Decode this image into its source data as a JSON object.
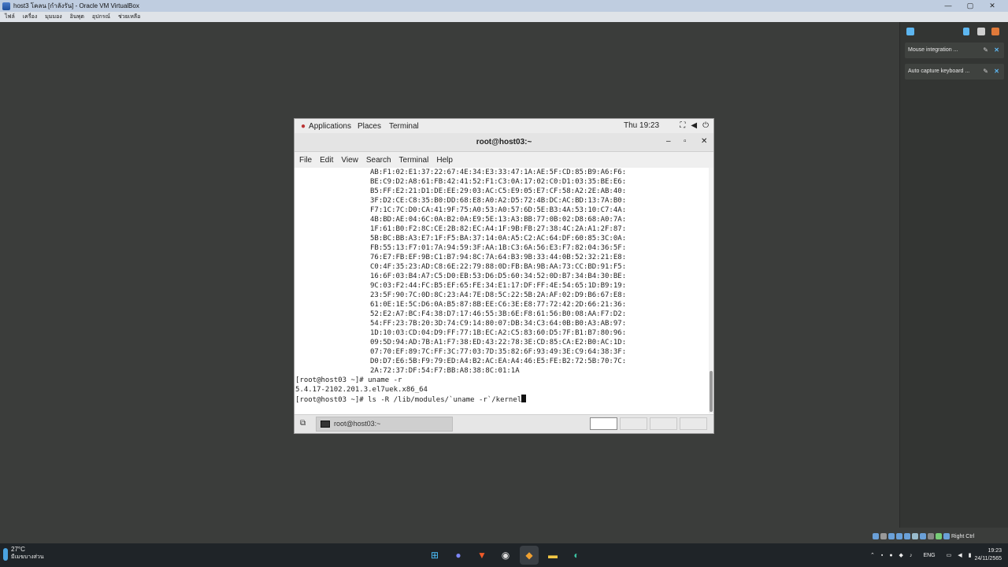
{
  "host_window": {
    "title": "host3 โคลน [กำลังรัน] - Oracle VM VirtualBox",
    "menu": [
      "ไฟล์",
      "เครื่อง",
      "มุมมอง",
      "อินพุต",
      "อุปกรณ์",
      "ช่วยเหลือ"
    ],
    "controls": [
      "—",
      "▢",
      "✕"
    ]
  },
  "side_panel": {
    "notifications": [
      {
        "label": "Mouse integration ..."
      },
      {
        "label": "Auto capture keyboard ..."
      }
    ]
  },
  "status_strip": {
    "host_key": "Right Ctrl"
  },
  "gnome": {
    "top_bar": {
      "applications": "Applications",
      "places": "Places",
      "terminal": "Terminal",
      "clock": "Thu 19:23"
    },
    "window_title": "root@host03:~",
    "window_controls": [
      "–",
      "▫",
      "✕"
    ],
    "menu": [
      "File",
      "Edit",
      "View",
      "Search",
      "Terminal",
      "Help"
    ],
    "terminal": {
      "hex_lines": [
        "AB:F1:02:E1:37:22:67:4E:34:E3:33:47:1A:AE:5F:CD:85:B9:A6:F6:",
        "BE:C9:D2:A8:61:FB:42:41:52:F1:C3:0A:17:02:C0:D1:03:35:BE:E6:",
        "B5:FF:E2:21:D1:DE:EE:29:03:AC:C5:E9:05:E7:CF:58:A2:2E:AB:40:",
        "3F:D2:CE:C8:35:B0:DD:68:E8:A0:A2:D5:72:4B:DC:AC:BD:13:7A:B0:",
        "F7:1C:7C:D0:CA:41:9F:75:A0:53:A0:57:6D:5E:B3:4A:53:10:C7:4A:",
        "4B:BD:AE:04:6C:0A:B2:0A:E9:5E:13:A3:BB:77:0B:02:D8:68:A0:7A:",
        "1F:61:B0:F2:8C:CE:2B:82:EC:A4:1F:9B:FB:27:38:4C:2A:A1:2F:87:",
        "5B:BC:BB:A3:E7:1F:F5:BA:37:14:0A:A5:C2:AC:64:DF:60:85:3C:0A:",
        "FB:55:13:F7:01:7A:94:59:3F:AA:1B:C3:6A:56:E3:F7:82:04:36:5F:",
        "76:E7:FB:EF:9B:C1:B7:94:8C:7A:64:B3:9B:33:44:0B:52:32:21:E8:",
        "C0:4F:35:23:AD:C8:6E:22:79:88:0D:FB:BA:9B:AA:73:CC:BD:91:F5:",
        "16:6F:03:B4:A7:C5:D0:EB:53:D6:D5:60:34:52:0D:B7:34:B4:30:BE:",
        "9C:03:F2:44:FC:B5:EF:65:FE:34:E1:17:DF:FF:4E:54:65:1D:B9:19:",
        "23:5F:90:7C:0D:8C:23:A4:7E:D8:5C:22:5B:2A:AF:02:D9:B6:67:E8:",
        "61:0E:1E:5C:D6:0A:B5:87:8B:EE:C6:3E:E8:77:72:42:2D:66:21:36:",
        "52:E2:A7:BC:F4:38:D7:17:46:55:3B:6E:F8:61:56:B0:08:AA:F7:D2:",
        "54:FF:23:7B:20:3D:74:C9:14:80:07:DB:34:C3:64:0B:B0:A3:AB:97:",
        "1D:10:03:CD:04:D9:FF:77:1B:EC:A2:C5:83:60:D5:7F:B1:B7:80:96:",
        "09:5D:94:AD:7B:A1:F7:38:ED:43:22:78:3E:CD:85:CA:E2:B0:AC:1D:",
        "07:70:EF:89:7C:FF:3C:77:03:7D:35:82:6F:93:49:3E:C9:64:38:3F:",
        "D0:D7:E6:5B:F9:79:ED:A4:B2:AC:EA:A4:46:E5:FE:B2:72:5B:70:7C:",
        "2A:72:37:DF:54:F7:BB:A8:38:8C:01:1A"
      ],
      "cmd1": "[root@host03 ~]# uname -r",
      "out1": "5.4.17-2102.201.3.el7uek.x86_64",
      "cmd2": "[root@host03 ~]# ls -R /lib/modules/`uname -r`/kernel"
    },
    "bottom_task": "root@host03:~"
  },
  "taskbar": {
    "temp": "27°C",
    "weather_desc": "มีเมฆบางส่วน",
    "lang": "ENG",
    "time": "19:23",
    "date": "24/11/2565"
  },
  "colors": {
    "vm_background": "#3b3d3b",
    "taskbar": "#1f2428",
    "accent": "#5db6f0"
  }
}
